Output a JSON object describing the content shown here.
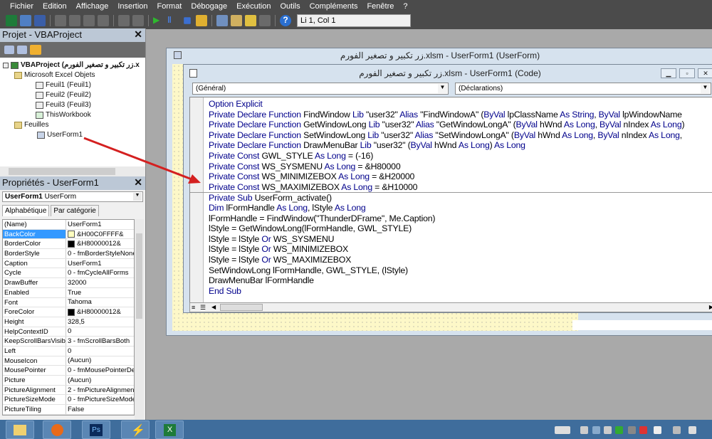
{
  "menu": [
    "Fichier",
    "Edition",
    "Affichage",
    "Insertion",
    "Format",
    "Débogage",
    "Exécution",
    "Outils",
    "Compléments",
    "Fenêtre",
    "?"
  ],
  "toolbar": {
    "position": "Li 1, Col 1"
  },
  "project": {
    "title": "Projet - VBAProject",
    "root": "VBAProject (زر تكبير و تصغير الفورم.x",
    "excel_folder": "Microsoft Excel Objets",
    "sheets": [
      "Feuil1 (Feuil1)",
      "Feuil2 (Feuil2)",
      "Feuil3 (Feuil3)",
      "ThisWorkbook"
    ],
    "forms_folder": "Feuilles",
    "form": "UserForm1"
  },
  "properties": {
    "title": "Propriétés - UserForm1",
    "object_name": "UserForm1",
    "object_type": "UserForm",
    "tabs": [
      "Alphabétique",
      "Par catégorie"
    ],
    "rows": [
      {
        "name": "(Name)",
        "value": "UserForm1"
      },
      {
        "name": "BackColor",
        "value": "&H00C0FFFF&",
        "swatch": "#ffffc0",
        "selected": true
      },
      {
        "name": "BorderColor",
        "value": "&H80000012&",
        "swatch": "#000000"
      },
      {
        "name": "BorderStyle",
        "value": "0 - fmBorderStyleNone"
      },
      {
        "name": "Caption",
        "value": "UserForm1"
      },
      {
        "name": "Cycle",
        "value": "0 - fmCycleAllForms"
      },
      {
        "name": "DrawBuffer",
        "value": "32000"
      },
      {
        "name": "Enabled",
        "value": "True"
      },
      {
        "name": "Font",
        "value": "Tahoma"
      },
      {
        "name": "ForeColor",
        "value": "&H80000012&",
        "swatch": "#000000"
      },
      {
        "name": "Height",
        "value": "328,5"
      },
      {
        "name": "HelpContextID",
        "value": "0"
      },
      {
        "name": "KeepScrollBarsVisible",
        "value": "3 - fmScrollBarsBoth"
      },
      {
        "name": "Left",
        "value": "0"
      },
      {
        "name": "MouseIcon",
        "value": "(Aucun)"
      },
      {
        "name": "MousePointer",
        "value": "0 - fmMousePointerDe"
      },
      {
        "name": "Picture",
        "value": "(Aucun)"
      },
      {
        "name": "PictureAlignment",
        "value": "2 - fmPictureAlignment"
      },
      {
        "name": "PictureSizeMode",
        "value": "0 - fmPictureSizeMode"
      },
      {
        "name": "PictureTiling",
        "value": "False"
      }
    ]
  },
  "userform_window": {
    "title": "زر تكبير و تصغير الفورم.xlsm - UserForm1 (UserForm)"
  },
  "code_window": {
    "title": "زر تكبير و تصغير الفورم.xlsm - UserForm1 (Code)",
    "object_combo": "(Général)",
    "proc_combo": "(Déclarations)",
    "lines": [
      [
        [
          "Option Explicit",
          "kw"
        ]
      ],
      [
        [
          "Private Declare Function ",
          "kw"
        ],
        [
          "FindWindow ",
          ""
        ],
        [
          "Lib ",
          "kw"
        ],
        [
          "\"user32\" ",
          ""
        ],
        [
          "Alias ",
          "kw"
        ],
        [
          "\"FindWindowA\" (",
          ""
        ],
        [
          "ByVal ",
          "kw"
        ],
        [
          "lpClassName ",
          ""
        ],
        [
          "As String",
          "kw"
        ],
        [
          ", ",
          ""
        ],
        [
          "ByVal ",
          "kw"
        ],
        [
          "lpWindowName",
          ""
        ]
      ],
      [
        [
          "Private Declare Function ",
          "kw"
        ],
        [
          "GetWindowLong ",
          ""
        ],
        [
          "Lib ",
          "kw"
        ],
        [
          "\"user32\" ",
          ""
        ],
        [
          "Alias ",
          "kw"
        ],
        [
          "\"GetWindowLongA\" (",
          ""
        ],
        [
          "ByVal ",
          "kw"
        ],
        [
          "hWnd ",
          ""
        ],
        [
          "As Long",
          "kw"
        ],
        [
          ", ",
          ""
        ],
        [
          "ByVal ",
          "kw"
        ],
        [
          "nIndex ",
          ""
        ],
        [
          "As Long",
          "kw"
        ],
        [
          ")",
          ""
        ]
      ],
      [
        [
          "Private Declare Function ",
          "kw"
        ],
        [
          "SetWindowLong ",
          ""
        ],
        [
          "Lib ",
          "kw"
        ],
        [
          "\"user32\" ",
          ""
        ],
        [
          "Alias ",
          "kw"
        ],
        [
          "\"SetWindowLongA\" (",
          ""
        ],
        [
          "ByVal ",
          "kw"
        ],
        [
          "hWnd ",
          ""
        ],
        [
          "As Long",
          "kw"
        ],
        [
          ", ",
          ""
        ],
        [
          "ByVal ",
          "kw"
        ],
        [
          "nIndex ",
          ""
        ],
        [
          "As Long",
          "kw"
        ],
        [
          ", ",
          ""
        ]
      ],
      [
        [
          "Private Declare Function ",
          "kw"
        ],
        [
          "DrawMenuBar ",
          ""
        ],
        [
          "Lib ",
          "kw"
        ],
        [
          "\"user32\" (",
          ""
        ],
        [
          "ByVal ",
          "kw"
        ],
        [
          "hWnd ",
          ""
        ],
        [
          "As Long",
          "kw"
        ],
        [
          ") ",
          ""
        ],
        [
          "As Long",
          "kw"
        ]
      ],
      [
        [
          "Private Const ",
          "kw"
        ],
        [
          "GWL_STYLE ",
          ""
        ],
        [
          "As Long",
          "kw"
        ],
        [
          " = (-16)",
          ""
        ]
      ],
      [
        [
          "Private Const ",
          "kw"
        ],
        [
          "WS_SYSMENU ",
          ""
        ],
        [
          "As Long",
          "kw"
        ],
        [
          " = &H80000",
          ""
        ]
      ],
      [
        [
          "Private Const ",
          "kw"
        ],
        [
          "WS_MINIMIZEBOX ",
          ""
        ],
        [
          "As Long",
          "kw"
        ],
        [
          " = &H20000",
          ""
        ]
      ],
      [
        [
          "Private Const ",
          "kw"
        ],
        [
          "WS_MAXIMIZEBOX ",
          ""
        ],
        [
          "As Long",
          "kw"
        ],
        [
          " = &H10000",
          ""
        ]
      ],
      [
        [
          "Private Sub ",
          "kw"
        ],
        [
          "UserForm_activate()",
          ""
        ]
      ],
      [
        [
          "Dim ",
          "kw"
        ],
        [
          "lFormHandle ",
          ""
        ],
        [
          "As Long",
          "kw"
        ],
        [
          ", ",
          ""
        ],
        [
          "lStyle ",
          ""
        ],
        [
          "As Long",
          "kw"
        ]
      ],
      [
        [
          "lFormHandle = FindWindow(\"ThunderDFrame\", Me.Caption)",
          ""
        ]
      ],
      [
        [
          "lStyle = GetWindowLong(lFormHandle, GWL_STYLE)",
          ""
        ]
      ],
      [
        [
          "lStyle = lStyle ",
          ""
        ],
        [
          "Or ",
          "kw"
        ],
        [
          "WS_SYSMENU",
          ""
        ]
      ],
      [
        [
          "lStyle = lStyle ",
          ""
        ],
        [
          "Or ",
          "kw"
        ],
        [
          "WS_MINIMIZEBOX",
          ""
        ]
      ],
      [
        [
          "lStyle = lStyle ",
          ""
        ],
        [
          "Or ",
          "kw"
        ],
        [
          "WS_MAXIMIZEBOX",
          ""
        ]
      ],
      [
        [
          "SetWindowLong lFormHandle, GWL_STYLE, (lStyle)",
          ""
        ]
      ],
      [
        [
          "DrawMenuBar lFormHandle",
          ""
        ]
      ],
      [
        [
          "End Sub",
          "kw"
        ]
      ]
    ]
  },
  "taskbar": {
    "apps": [
      "file-explorer",
      "firefox",
      "photoshop",
      "winamp",
      "excel"
    ]
  },
  "colors": {
    "keyword": "#00008b",
    "menu_bg": "#4b4b4b",
    "taskbar": "#3f6d9c",
    "arrow": "#d42020"
  }
}
